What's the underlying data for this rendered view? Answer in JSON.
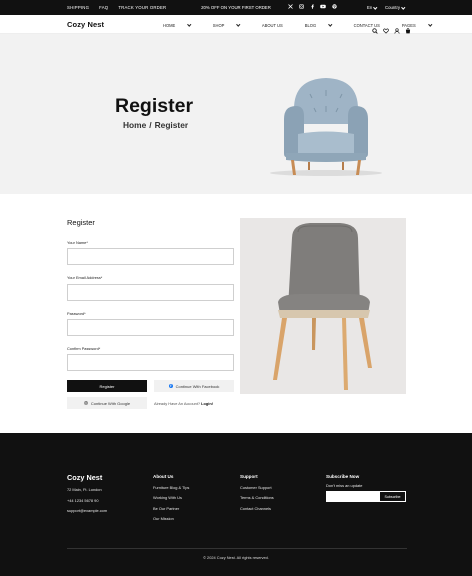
{
  "topbar": {
    "links": [
      "SHIPPING",
      "FAQ",
      "TRACK YOUR ORDER"
    ],
    "promo": "20% OFF ON YOUR FIRST ORDER",
    "social_icons": [
      "x-icon",
      "instagram-icon",
      "facebook-icon",
      "youtube-icon",
      "pinterest-icon"
    ],
    "language": "En",
    "country": "Country"
  },
  "header": {
    "logo": "Cozy Nest",
    "nav": [
      {
        "label": "HOME",
        "dropdown": true
      },
      {
        "label": "SHOP",
        "dropdown": true
      },
      {
        "label": "ABOUT US",
        "dropdown": false
      },
      {
        "label": "BLOG",
        "dropdown": true
      },
      {
        "label": "CONTACT US",
        "dropdown": false
      },
      {
        "label": "PAGES",
        "dropdown": true
      }
    ],
    "icons": [
      "search-icon",
      "heart-icon",
      "user-icon",
      "cart-icon"
    ]
  },
  "hero": {
    "title": "Register",
    "crumb_home": "Home",
    "crumb_sep": "/",
    "crumb_current": "Register"
  },
  "form": {
    "title": "Register",
    "name_label": "Your Name*",
    "email_label": "Your Email Address*",
    "password_label": "Password*",
    "confirm_label": "Confirm Password*",
    "register_button": "Register",
    "facebook_button": "Continue With Facebook",
    "google_button": "Continue With Google",
    "already_text": "Already Have An Account?",
    "login_link": "Login!"
  },
  "footer": {
    "logo": "Cozy Nest",
    "address": "72 Main, Ft. London",
    "phone": "+44 1234 5678 90",
    "email": "support@example.com",
    "about_title": "About Us",
    "about_links": [
      "Furniture Blog & Tips",
      "Working With Us",
      "Be Our Partner",
      "Our Mission"
    ],
    "support_title": "Support",
    "support_links": [
      "Customer Support",
      "Terms & Conditions",
      "Contact Channels"
    ],
    "subscribe_title": "Subscribe Now",
    "subscribe_text": "Don't miss an update",
    "subscribe_button": "Subscribe",
    "copyright": "© 2024 Cozy Nest. All rights reserved."
  },
  "colors": {
    "dark": "#111111",
    "hero_bg": "#f2f2f2",
    "facebook": "#1877f2"
  }
}
